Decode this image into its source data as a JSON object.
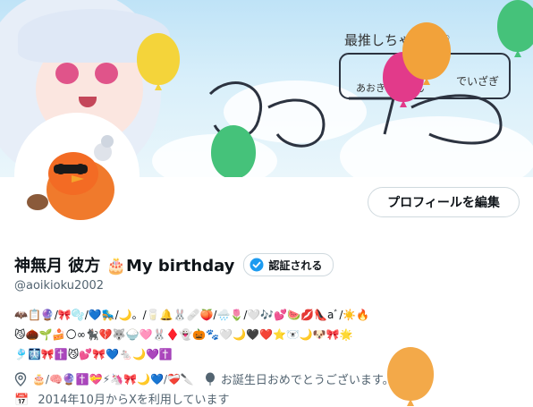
{
  "banner": {
    "handwriting_line1": "最推しちゃんっ♡",
    "handwriting_line2": "あおきまっすん",
    "handwriting_line3": "でいざぎ"
  },
  "profile": {
    "edit_button_label": "プロフィールを編集",
    "display_name": "神無月 彼方 🎂My birthday",
    "verify_label": "認証される",
    "handle": "@aoikioku2002",
    "bio_lines": [
      "🦇📋🔮/🎀🫧/💙🛼/🌙。/🥛🔔🐰🩹🍑/🌧️🌷/🤍🎶💕🍉💋👠aﾞ/☀️🔥",
      "😼🌰🌱🍰🌕∞🐈‍⬛💔🐺🍚🩷🐰♦️👻🎃🐾🤍🌙🖤❤️⭐🐻‍❄️🌙🐶🎀🌟",
      "🎐🩻🎀✝️😼💕🎀💙🐁🌙💜✝️"
    ],
    "meta_items": "🎂/🧠🔮✝️💝⚡🦄🎀🌙💙/❤️‍🩹🔪",
    "birthday_message": "お誕生日おめでとうございます。",
    "joined_text": "2014年10月からXを利用しています"
  },
  "colors": {
    "accent": "#1d9bf0",
    "text": "#0f1419",
    "muted": "#536471",
    "border": "#cfd9de"
  }
}
